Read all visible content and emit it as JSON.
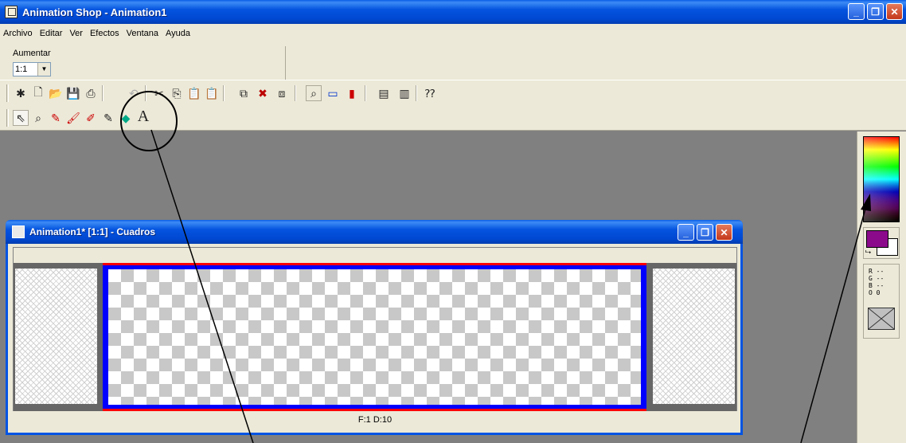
{
  "window": {
    "title": "Animation Shop - Animation1",
    "minimize": "_",
    "maximize": "❐",
    "close": "✕"
  },
  "menu": [
    "Archivo",
    "Editar",
    "Ver",
    "Efectos",
    "Ventana",
    "Ayuda"
  ],
  "zoom": {
    "label": "Aumentar",
    "value": "1:1"
  },
  "toolbar_main": {
    "icons": [
      "new-wizard-icon",
      "new-icon",
      "open-icon",
      "save-icon",
      "print-icon",
      "undo-icon",
      "cut-icon",
      "copy-icon",
      "paste-icon",
      "paste-disabled-icon",
      "insert-frames-icon",
      "delete-frames-icon",
      "copy-frames-icon",
      "zoom-icon",
      "frame-properties-icon",
      "color-bars-icon",
      "view-frames-icon",
      "view-animation-icon",
      "help-icon"
    ]
  },
  "toolbar_tools": {
    "icons": [
      "arrow-tool-icon",
      "zoom-tool-icon",
      "pencil-tool-icon",
      "brush-tool-icon",
      "eraser-tool-icon",
      "fill-tool-icon",
      "text-tool-icon"
    ],
    "text_tool_glyph": "A"
  },
  "child_window": {
    "title": "Animation1* [1:1] - Cuadros",
    "status": "F:1  D:10"
  },
  "color_panel": {
    "foreground": "#8b0a8b",
    "background": "#ffffff",
    "r": "R --",
    "g": "G --",
    "b": "B --",
    "o": "O 0"
  },
  "accent": {
    "titlebar": "#0054e3",
    "frame_border_red": "#ff0000",
    "frame_border_blue": "#0000ff"
  }
}
